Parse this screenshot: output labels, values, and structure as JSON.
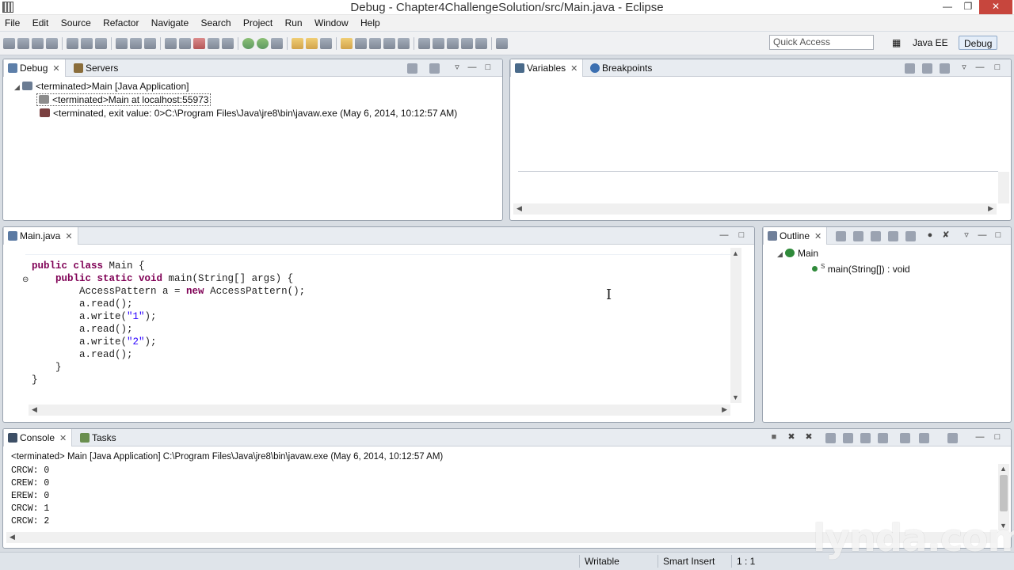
{
  "window": {
    "title": "Debug - Chapter4ChallengeSolution/src/Main.java - Eclipse"
  },
  "menu": [
    "File",
    "Edit",
    "Source",
    "Refactor",
    "Navigate",
    "Search",
    "Project",
    "Run",
    "Window",
    "Help"
  ],
  "toolbar": {
    "quick_access_placeholder": "Quick Access",
    "perspective_java_ee": "Java EE",
    "perspective_debug": "Debug"
  },
  "debug_view": {
    "tabs": [
      "Debug",
      "Servers"
    ],
    "tree": [
      "<terminated>Main [Java Application]",
      "<terminated>Main at localhost:55973",
      "<terminated, exit value: 0>C:\\Program Files\\Java\\jre8\\bin\\javaw.exe (May 6, 2014, 10:12:57 AM)"
    ]
  },
  "variables_view": {
    "tabs": [
      "Variables",
      "Breakpoints"
    ]
  },
  "editor": {
    "tab": "Main.java",
    "code": [
      "public class Main {",
      "    public static void main(String[] args) {",
      "        AccessPattern a = new AccessPattern();",
      "        a.read();",
      "        a.write(\"1\");",
      "        a.read();",
      "        a.write(\"2\");",
      "        a.read();",
      "    }",
      "}"
    ]
  },
  "outline_view": {
    "tab": "Outline",
    "class_name": "Main",
    "method": "main(String[]) : void",
    "static_marker": "S"
  },
  "console_view": {
    "tabs": [
      "Console",
      "Tasks"
    ],
    "header": "<terminated> Main [Java Application] C:\\Program Files\\Java\\jre8\\bin\\javaw.exe (May 6, 2014, 10:12:57 AM)",
    "lines": [
      "CRCW: 0",
      "CREW: 0",
      "EREW: 0",
      "CRCW: 1",
      "CRCW: 2"
    ]
  },
  "statusbar": {
    "writable": "Writable",
    "insert_mode": "Smart Insert",
    "position": "1 : 1"
  },
  "watermark": "lynda.com"
}
